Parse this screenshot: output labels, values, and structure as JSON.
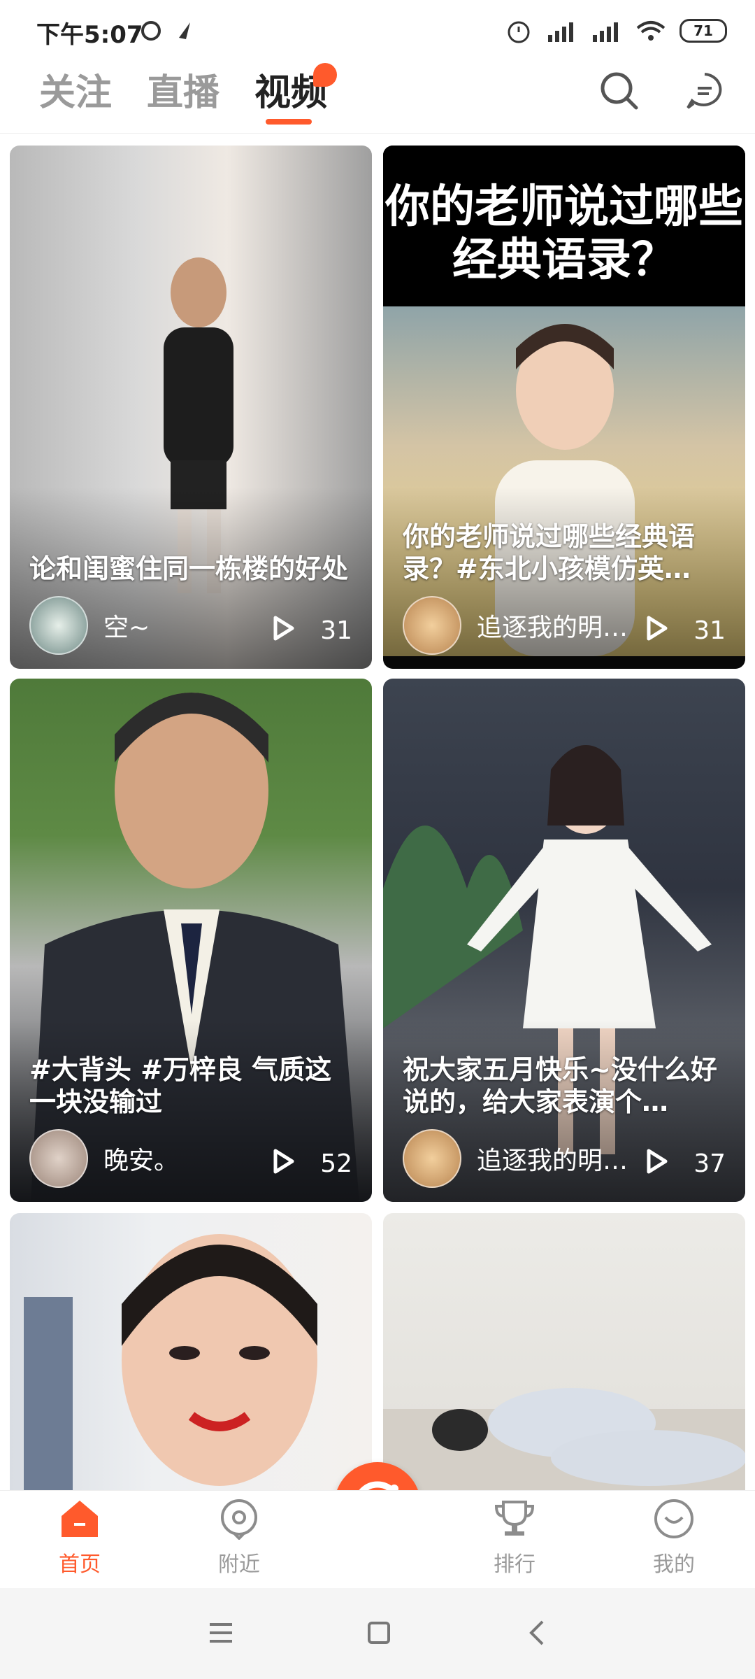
{
  "status": {
    "time": "下午5:07",
    "battery": "71"
  },
  "tabs": [
    {
      "label": "关注",
      "active": false
    },
    {
      "label": "直播",
      "active": false
    },
    {
      "label": "视频",
      "active": true
    }
  ],
  "icons": {
    "search": "search-icon",
    "message": "message-icon"
  },
  "cards": [
    {
      "title": "论和闺蜜住同一栋楼的好处",
      "author": "空~",
      "plays": "31"
    },
    {
      "headline": "你的老师说过哪些经典语录？",
      "title": "你的老师说过哪些经典语录？#东北小孩模仿英…",
      "author": "追逐我的明…",
      "plays": "31"
    },
    {
      "title": "#大背头 #万梓良 气质这一块没输过",
      "author": "晚安。",
      "plays": "52"
    },
    {
      "title": "祝大家五月快乐~没什么好说的，给大家表演个…",
      "author": "追逐我的明…",
      "plays": "37"
    },
    {
      "title": "",
      "author": "",
      "plays": ""
    },
    {
      "title": "",
      "author": "",
      "plays": ""
    }
  ],
  "bottom_nav": [
    {
      "label": "首页",
      "active": true
    },
    {
      "label": "附近",
      "active": false
    },
    {
      "label": "排行",
      "active": false
    },
    {
      "label": "我的",
      "active": false
    }
  ],
  "colors": {
    "accent": "#ff5a2c",
    "inactive": "#9a9a9a"
  }
}
